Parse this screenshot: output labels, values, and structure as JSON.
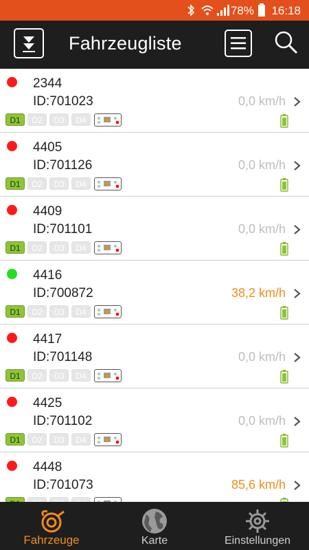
{
  "status_bar": {
    "battery_percent": "78%",
    "time": "16:18"
  },
  "header": {
    "title": "Fahrzeugliste"
  },
  "vehicles": [
    {
      "name": "2344",
      "id": "ID:701023",
      "speed": "0,0 km/h",
      "status_color": "#ff1a1a",
      "moving": false
    },
    {
      "name": "4405",
      "id": "ID:701126",
      "speed": "0,0 km/h",
      "status_color": "#ff1a1a",
      "moving": false
    },
    {
      "name": "4409",
      "id": "ID:701101",
      "speed": "0,0 km/h",
      "status_color": "#ff1a1a",
      "moving": false
    },
    {
      "name": "4416",
      "id": "ID:700872",
      "speed": "38,2 km/h",
      "status_color": "#22e01e",
      "moving": true
    },
    {
      "name": "4417",
      "id": "ID:701148",
      "speed": "0,0 km/h",
      "status_color": "#ff1a1a",
      "moving": false
    },
    {
      "name": "4425",
      "id": "ID:701102",
      "speed": "0,0 km/h",
      "status_color": "#ff1a1a",
      "moving": false
    },
    {
      "name": "4448",
      "id": "ID:701073",
      "speed": "85,6 km/h",
      "status_color": "#ff1a1a",
      "moving": true
    }
  ],
  "driver_badges": [
    "D1",
    "D2",
    "D3",
    "D4"
  ],
  "bottom_nav": [
    {
      "label": "Fahrzeuge",
      "icon": "horn-icon",
      "active": true
    },
    {
      "label": "Karte",
      "icon": "globe-icon",
      "active": false
    },
    {
      "label": "Einstellungen",
      "icon": "gear-icon",
      "active": false
    }
  ],
  "colors": {
    "accent": "#f28c1a",
    "status_bar": "#e4501c",
    "bar_bg": "#1e1e1e"
  }
}
